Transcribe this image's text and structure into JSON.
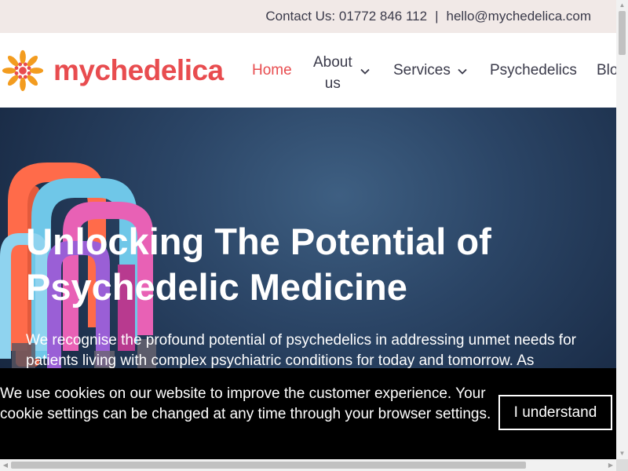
{
  "topbar": {
    "contact_label": "Contact Us: 01772 846 112",
    "separator": "|",
    "email": "hello@mychedelica.com"
  },
  "header": {
    "logo_text": "mychedelica",
    "nav": {
      "home": "Home",
      "about_line1": "About",
      "about_line2": "us",
      "services": "Services",
      "psychedelics": "Psychedelics",
      "blog": "Blo"
    }
  },
  "hero": {
    "title_line1": "Unlocking The Potential of",
    "title_line2": "Psychedelic Medicine",
    "body": "We recognise the profound potential of psychedelics in addressing unmet needs for patients living with complex psychiatric conditions for today and tomorrow. As"
  },
  "cookie_banner": {
    "message": "We use cookies on our website to improve the customer experience. Your cookie settings can be changed at any time through your browser settings.",
    "button_label": "I understand"
  },
  "colors": {
    "brand_red": "#e84c4f",
    "brand_orange": "#f39c1f",
    "topbar_bg": "#f1e9e7",
    "hero_bg": "#2b4566"
  },
  "icons": {
    "logo": "sun-flower-logo-icon",
    "dropdown": "chevron-down-icon"
  }
}
